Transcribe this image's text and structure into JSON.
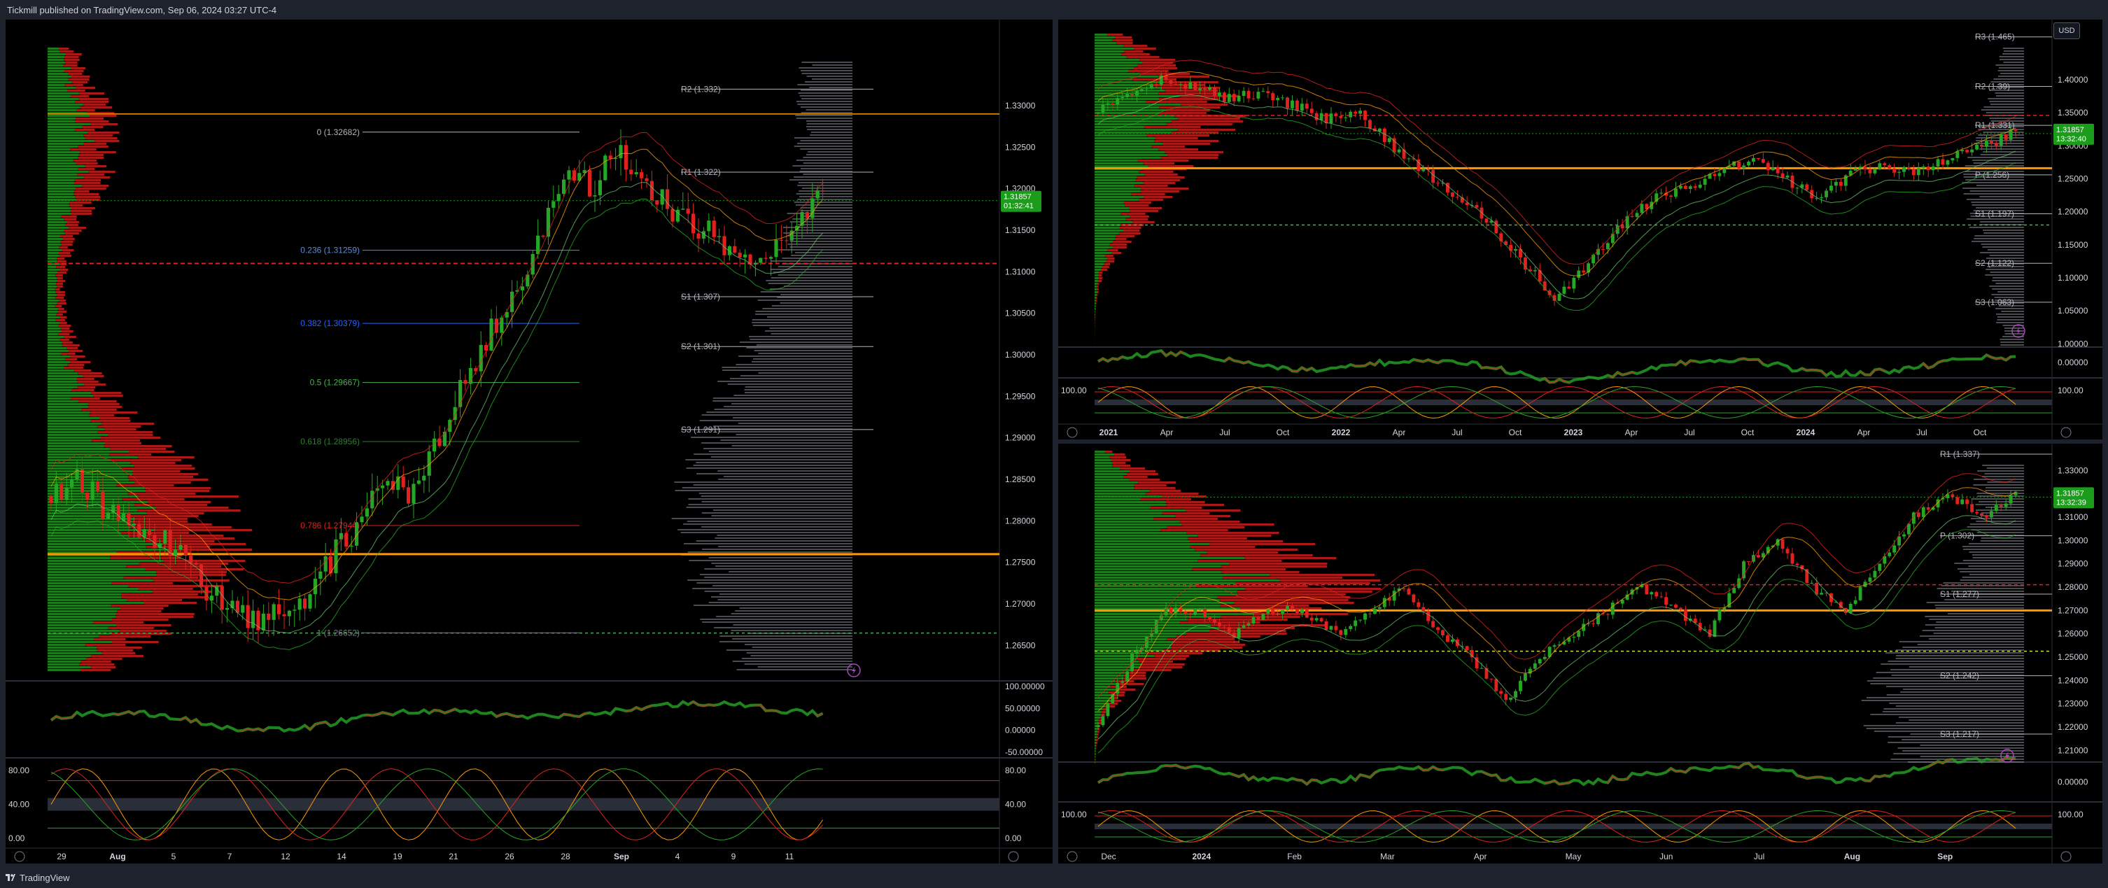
{
  "header": {
    "title": "Tickmill published on TradingView.com, Sep 06, 2024 03:27 UTC-4"
  },
  "footer": {
    "brand": "TradingView"
  },
  "currency": "USD",
  "colors": {
    "bull": "#26a626",
    "bear": "#e0211f",
    "accent": "#ff9800",
    "fib": "#787b86",
    "price_label": "#1b9d1b"
  },
  "chart_data": [
    {
      "type": "candlestick",
      "panel": "left",
      "x_ticks": [
        "29",
        "Aug",
        "5",
        "7",
        "12",
        "14",
        "19",
        "21",
        "26",
        "28",
        "Sep",
        "4",
        "9",
        "11"
      ],
      "y_ticks": [
        "1.33000",
        "1.32500",
        "1.32000",
        "1.31500",
        "1.31000",
        "1.30500",
        "1.30000",
        "1.29500",
        "1.29000",
        "1.28500",
        "1.28000",
        "1.27500",
        "1.27000",
        "1.26500"
      ],
      "ylim": [
        1.262,
        1.337
      ],
      "last_price": "1.31857",
      "countdown": "01:32:41",
      "fib_levels": [
        {
          "label": "0 (1.32682)",
          "value": 1.32682
        },
        {
          "label": "0.236 (1.31259)",
          "value": 1.31259
        },
        {
          "label": "0.382 (1.30379)",
          "value": 1.30379
        },
        {
          "label": "0.5 (1.29667)",
          "value": 1.29667
        },
        {
          "label": "0.618 (1.28956)",
          "value": 1.28956
        },
        {
          "label": "0.786 (1.27944)",
          "value": 1.27944
        },
        {
          "label": "1 (1.26652)",
          "value": 1.26652
        }
      ],
      "pivots": [
        {
          "label": "R2 (1.332)",
          "value": 1.332
        },
        {
          "label": "R1 (1.322)",
          "value": 1.322
        },
        {
          "label": "S1 (1.307)",
          "value": 1.307
        },
        {
          "label": "S2 (1.301)",
          "value": 1.301
        },
        {
          "label": "S3 (1.291)",
          "value": 1.291
        }
      ],
      "price_path": [
        1.283,
        1.285,
        1.282,
        1.28,
        1.278,
        1.277,
        1.272,
        1.27,
        1.268,
        1.269,
        1.27,
        1.276,
        1.279,
        1.285,
        1.283,
        1.29,
        1.297,
        1.302,
        1.308,
        1.313,
        1.323,
        1.32,
        1.325,
        1.32,
        1.318,
        1.315,
        1.314,
        1.311,
        1.313,
        1.316,
        1.3186
      ],
      "oscillator_ticks": [
        "100.00000",
        "50.00000",
        "0.00000",
        "-50.00000"
      ],
      "stoch_ticks": [
        "80.00",
        "40.00",
        "0.00"
      ]
    },
    {
      "type": "candlestick",
      "panel": "top-right",
      "x_ticks": [
        "2021",
        "Apr",
        "Jul",
        "Oct",
        "2022",
        "Apr",
        "Jul",
        "Oct",
        "2023",
        "Apr",
        "Jul",
        "Oct",
        "2024",
        "Apr",
        "Jul",
        "Oct"
      ],
      "y_ticks": [
        "1.40000",
        "1.35000",
        "1.30000",
        "1.25000",
        "1.20000",
        "1.15000",
        "1.10000",
        "1.05000",
        "1.00000"
      ],
      "ylim": [
        0.995,
        1.47
      ],
      "last_price": "1.31857",
      "countdown": "13:32:40",
      "pivots": [
        {
          "label": "R3 (1.465)",
          "value": 1.465
        },
        {
          "label": "R2 (1.39)",
          "value": 1.39
        },
        {
          "label": "R1 (1.331)",
          "value": 1.331
        },
        {
          "label": "P (1.256)",
          "value": 1.256
        },
        {
          "label": "S1 (1.197)",
          "value": 1.197
        },
        {
          "label": "S2 (1.122)",
          "value": 1.122
        },
        {
          "label": "S3 (1.063)",
          "value": 1.063
        }
      ],
      "price_path": [
        1.35,
        1.38,
        1.4,
        1.39,
        1.37,
        1.38,
        1.36,
        1.34,
        1.35,
        1.3,
        1.26,
        1.22,
        1.18,
        1.12,
        1.07,
        1.12,
        1.18,
        1.22,
        1.24,
        1.26,
        1.28,
        1.25,
        1.22,
        1.26,
        1.27,
        1.26,
        1.28,
        1.3,
        1.32
      ],
      "oscillator_ticks": [
        "0.00000"
      ],
      "stoch_ticks": [
        "100.00"
      ]
    },
    {
      "type": "candlestick",
      "panel": "bottom-right",
      "x_ticks": [
        "Dec",
        "2024",
        "Feb",
        "Mar",
        "Apr",
        "May",
        "Jun",
        "Jul",
        "Aug",
        "Sep"
      ],
      "y_ticks": [
        "1.33000",
        "1.32000",
        "1.31000",
        "1.30000",
        "1.29000",
        "1.28000",
        "1.27000",
        "1.26000",
        "1.25000",
        "1.24000",
        "1.23000",
        "1.22000",
        "1.21000"
      ],
      "ylim": [
        1.205,
        1.3385
      ],
      "last_price": "1.31857",
      "countdown": "13:32:39",
      "pivots": [
        {
          "label": "R1 (1.337)",
          "value": 1.337
        },
        {
          "label": "P (1.302)",
          "value": 1.302
        },
        {
          "label": "S1 (1.277)",
          "value": 1.277
        },
        {
          "label": "S2 (1.242)",
          "value": 1.242
        },
        {
          "label": "S3 (1.217)",
          "value": 1.217
        }
      ],
      "price_path": [
        1.22,
        1.25,
        1.27,
        1.27,
        1.26,
        1.27,
        1.27,
        1.26,
        1.27,
        1.28,
        1.26,
        1.25,
        1.23,
        1.25,
        1.26,
        1.27,
        1.28,
        1.27,
        1.26,
        1.29,
        1.3,
        1.28,
        1.27,
        1.29,
        1.31,
        1.32,
        1.31,
        1.319
      ],
      "oscillator_ticks": [
        "0.00000"
      ],
      "stoch_ticks": [
        "100.00"
      ]
    }
  ]
}
